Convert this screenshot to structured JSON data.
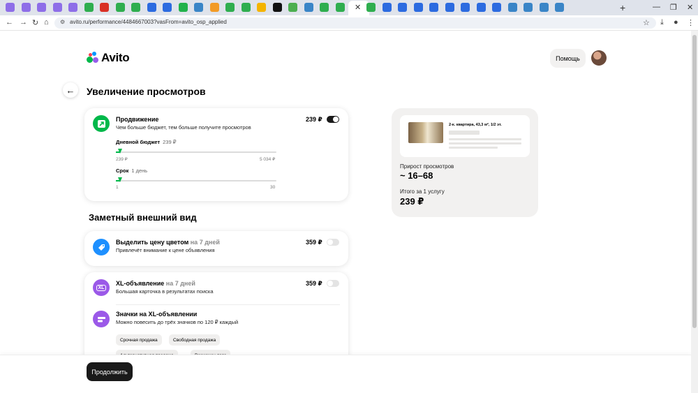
{
  "browser": {
    "url": "avito.ru/performance/4484667003?vasFrom=avito_osp_applied",
    "tab_colors": [
      "#8e6ee8",
      "#8e6ee8",
      "#8e6ee8",
      "#8e6ee8",
      "#8e6ee8",
      "#2fae4f",
      "#d93025",
      "#2fae4f",
      "#2fae4f",
      "#2c6be0",
      "#2c6be0",
      "#22b24c",
      "#3a85c7",
      "#f29b27",
      "#2fae4f",
      "#2fae4f",
      "#f4b400",
      "#111111",
      "#4caf50",
      "#3a85c7",
      "#2fae4f",
      "#2fae4f",
      "#2fae4f",
      "#2fae4f",
      "#2c6be0",
      "#2c6be0",
      "#2c6be0",
      "#2c6be0",
      "#2c6be0",
      "#2c6be0",
      "#2c6be0",
      "#2c6be0",
      "#3a85c7",
      "#3a85c7",
      "#3a85c7",
      "#3a85c7"
    ]
  },
  "header": {
    "logo_text": "Avito",
    "help_label": "Помощь"
  },
  "page": {
    "title": "Увеличение просмотров",
    "section_title": "Заметный внешний вид"
  },
  "promotion": {
    "title": "Продвижение",
    "subtitle": "Чем больше бюджет, тем больше получите просмотров",
    "price": "239 ₽",
    "enabled": true,
    "budget_label": "Дневной бюджет",
    "budget_value": "239 ₽",
    "budget_min": "239 ₽",
    "budget_max": "5 034 ₽",
    "budget_fraction": 0.0,
    "term_label": "Срок",
    "term_value": "1 день",
    "term_min": "1",
    "term_max": "30",
    "term_fraction": 0.0
  },
  "highlight": {
    "title": "Выделить цену цветом",
    "title_suffix": "на 7 дней",
    "subtitle": "Привлечёт внимание к цене объявления",
    "price": "359 ₽",
    "enabled": false
  },
  "xl": {
    "icon_text": "XL",
    "title": "XL-объявление",
    "title_suffix": "на 7 дней",
    "subtitle": "Большая карточка в результатах поиска",
    "price": "359 ₽",
    "enabled": false
  },
  "badges": {
    "title": "Значки на XL-объявлении",
    "subtitle": "Можно повесить до трёх значков по 120 ₽ каждый",
    "chips": [
      "Срочная продажа",
      "Свободная продажа",
      "Альтернативная продажа",
      "Возможен торг"
    ]
  },
  "preview": {
    "listing_title": "2-к. квартира, 43,3 м², 1/2 эт.",
    "growth_label": "Прирост просмотров",
    "growth_value": "~ 16–68",
    "total_label": "Итого за 1 услугу",
    "total_value": "239 ₽"
  },
  "footer": {
    "continue_label": "Продолжить"
  },
  "colors": {
    "accent_green": "#00b84a",
    "highlight_blue": "#1e90ff",
    "xl_purple": "#9b59e8"
  }
}
